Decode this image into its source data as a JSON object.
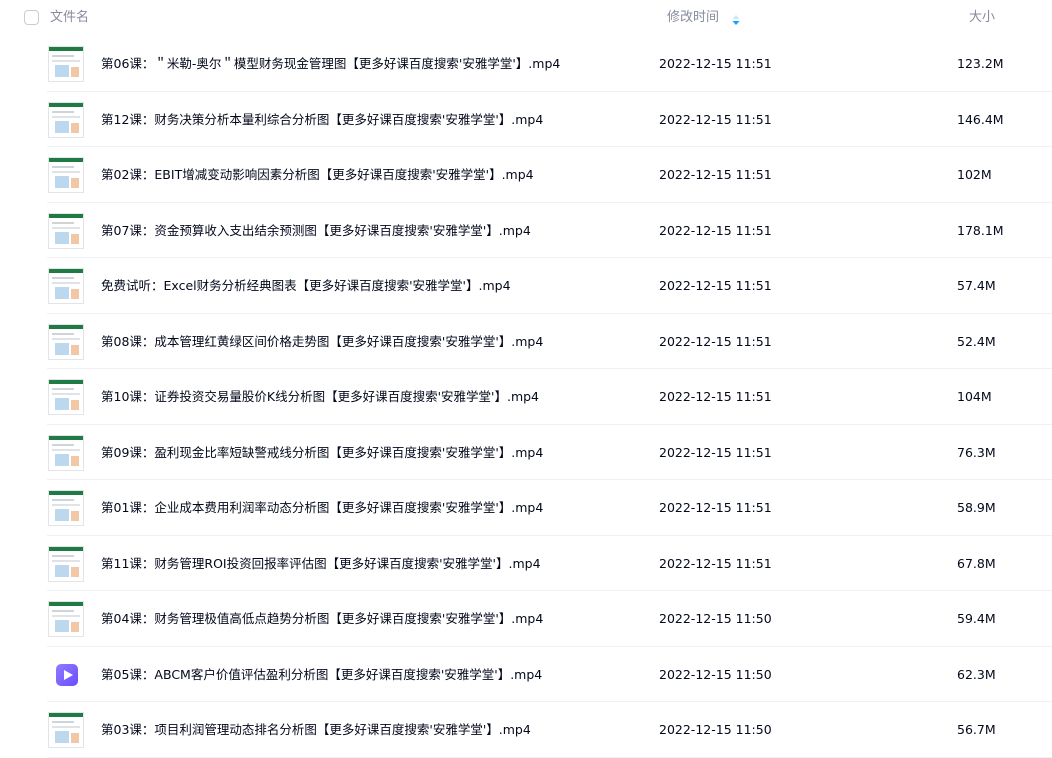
{
  "header": {
    "name_label": "文件名",
    "time_label": "修改时间",
    "size_label": "大小",
    "sort_icon": "sort-descending-icon",
    "sort_color": "#06a7ff"
  },
  "files": [
    {
      "name": "第06课：＂米勒-奥尔＂模型财务现金管理图【更多好课百度搜索'安雅学堂'】.mp4",
      "time": "2022-12-15 11:51",
      "size": "123.2M",
      "icon": "video-thumbnail"
    },
    {
      "name": "第12课：财务决策分析本量利综合分析图【更多好课百度搜索'安雅学堂'】.mp4",
      "time": "2022-12-15 11:51",
      "size": "146.4M",
      "icon": "video-thumbnail"
    },
    {
      "name": "第02课：EBIT增减变动影响因素分析图【更多好课百度搜索'安雅学堂'】.mp4",
      "time": "2022-12-15 11:51",
      "size": "102M",
      "icon": "video-thumbnail"
    },
    {
      "name": "第07课：资金预算收入支出结余预测图【更多好课百度搜索'安雅学堂'】.mp4",
      "time": "2022-12-15 11:51",
      "size": "178.1M",
      "icon": "video-thumbnail"
    },
    {
      "name": "免费试听：Excel财务分析经典图表【更多好课百度搜索'安雅学堂'】.mp4",
      "time": "2022-12-15 11:51",
      "size": "57.4M",
      "icon": "video-thumbnail"
    },
    {
      "name": "第08课：成本管理红黄绿区间价格走势图【更多好课百度搜索'安雅学堂'】.mp4",
      "time": "2022-12-15 11:51",
      "size": "52.4M",
      "icon": "video-thumbnail"
    },
    {
      "name": "第10课：证券投资交易量股价K线分析图【更多好课百度搜索'安雅学堂'】.mp4",
      "time": "2022-12-15 11:51",
      "size": "104M",
      "icon": "video-thumbnail"
    },
    {
      "name": "第09课：盈利现金比率短缺警戒线分析图【更多好课百度搜索'安雅学堂'】.mp4",
      "time": "2022-12-15 11:51",
      "size": "76.3M",
      "icon": "video-thumbnail"
    },
    {
      "name": "第01课：企业成本费用利润率动态分析图【更多好课百度搜索'安雅学堂'】.mp4",
      "time": "2022-12-15 11:51",
      "size": "58.9M",
      "icon": "video-thumbnail"
    },
    {
      "name": "第11课：财务管理ROI投资回报率评估图【更多好课百度搜索'安雅学堂'】.mp4",
      "time": "2022-12-15 11:51",
      "size": "67.8M",
      "icon": "video-thumbnail"
    },
    {
      "name": "第04课：财务管理极值高低点趋势分析图【更多好课百度搜索'安雅学堂'】.mp4",
      "time": "2022-12-15 11:50",
      "size": "59.4M",
      "icon": "video-thumbnail"
    },
    {
      "name": "第05课：ABCM客户价值评估盈利分析图【更多好课百度搜索'安雅学堂'】.mp4",
      "time": "2022-12-15 11:50",
      "size": "62.3M",
      "icon": "video-file-icon"
    },
    {
      "name": "第03课：项目利润管理动态排名分析图【更多好课百度搜索'安雅学堂'】.mp4",
      "time": "2022-12-15 11:50",
      "size": "56.7M",
      "icon": "video-thumbnail"
    }
  ]
}
